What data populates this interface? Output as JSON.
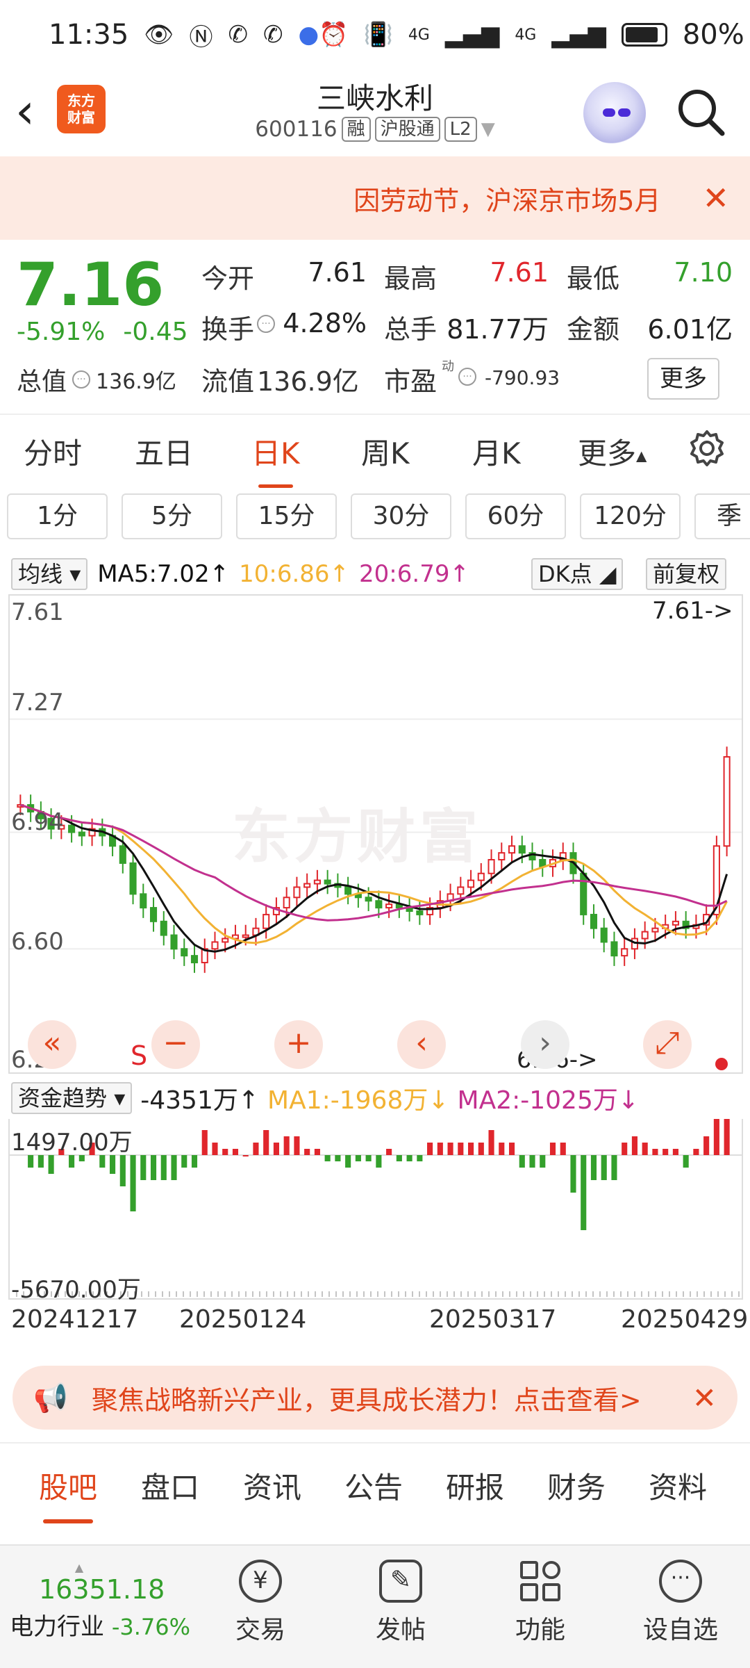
{
  "status_bar": {
    "time": "11:35",
    "battery": "80%",
    "net1": "4G",
    "net2": "4G"
  },
  "header": {
    "logo_text": "东方财富",
    "title": "三峡水利",
    "code": "600116",
    "tags": [
      "融",
      "沪股通",
      "L2"
    ]
  },
  "notice": {
    "text": "因劳动节，沪深京市场5月"
  },
  "quote": {
    "price": "7.16",
    "pct": "-5.91%",
    "change": "-0.45",
    "fields": [
      {
        "label": "今开",
        "value": "7.61"
      },
      {
        "label": "最高",
        "value": "7.61"
      },
      {
        "label": "最低",
        "value": "7.10"
      },
      {
        "label": "换手",
        "value": "4.28%"
      },
      {
        "label": "总手",
        "value": "81.77万"
      },
      {
        "label": "金额",
        "value": "6.01亿"
      }
    ],
    "total_label": "总值",
    "total_value": "136.9亿",
    "float_label": "流值",
    "float_value": "136.9亿",
    "pe_label": "市盈",
    "pe_sup": "动",
    "pe_value": "-790.93",
    "more": "更多"
  },
  "period_tabs": [
    "分时",
    "五日",
    "日K",
    "周K",
    "月K",
    "更多"
  ],
  "active_period": "日K",
  "minute_buttons": [
    "1分",
    "5分",
    "15分",
    "30分",
    "60分",
    "120分",
    "季"
  ],
  "ma_legend": {
    "selector": "均线",
    "ma5": "MA5:7.02↑",
    "ma10": "10:6.86↑",
    "ma20": "20:6.79↑",
    "dk": "DK点",
    "adjust": "前复权"
  },
  "kline": {
    "y_labels": [
      "7.61",
      "7.27",
      "6.94",
      "6.60",
      "6.26"
    ],
    "high_marker": "7.61->",
    "low_marker": "6.26->",
    "watermark": "东方财富",
    "s_marker": "S"
  },
  "fund_legend": {
    "selector": "资金趋势",
    "value": "-4351万↑",
    "ma1": "MA1:-1968万↓",
    "ma2": "MA2:-1025万↓"
  },
  "fund_chart": {
    "top_label": "1497.00万",
    "bottom_label": "-5670.00万"
  },
  "dates": [
    "20241217",
    "20250124",
    "20250317",
    "20250429"
  ],
  "promo": {
    "text": "聚焦战略新兴产业，更具成长潜力！点击查看>"
  },
  "content_tabs": [
    "股吧",
    "盘口",
    "资讯",
    "公告",
    "研报",
    "财务",
    "资料"
  ],
  "active_content_tab": "股吧",
  "bottom_nav": {
    "index_value": "16351.18",
    "index_name": "电力行业",
    "index_pct": "-3.76%",
    "items": [
      "交易",
      "发帖",
      "功能",
      "设自选"
    ]
  },
  "colors": {
    "up": "#e0262c",
    "down": "#34a02c",
    "accent": "#e0451b",
    "ma5": "#111111",
    "ma10": "#f2b233",
    "ma20": "#c2308e"
  },
  "chart_data": {
    "type": "candlestick",
    "y_range": [
      6.26,
      7.61
    ],
    "x_ticks": [
      "20241217",
      "20250124",
      "20250317",
      "20250429"
    ],
    "closes_approx": [
      7.02,
      7.0,
      6.98,
      6.95,
      6.96,
      6.94,
      6.93,
      6.95,
      6.93,
      6.9,
      6.85,
      6.76,
      6.72,
      6.68,
      6.64,
      6.6,
      6.58,
      6.56,
      6.6,
      6.62,
      6.63,
      6.64,
      6.64,
      6.66,
      6.7,
      6.72,
      6.75,
      6.78,
      6.79,
      6.8,
      6.79,
      6.78,
      6.76,
      6.75,
      6.74,
      6.72,
      6.73,
      6.72,
      6.71,
      6.7,
      6.72,
      6.74,
      6.76,
      6.78,
      6.8,
      6.82,
      6.86,
      6.88,
      6.9,
      6.88,
      6.86,
      6.84,
      6.86,
      6.88,
      6.82,
      6.7,
      6.66,
      6.62,
      6.58,
      6.6,
      6.63,
      6.65,
      6.66,
      6.67,
      6.68,
      6.66,
      6.67,
      6.7,
      6.9,
      7.16
    ]
  }
}
